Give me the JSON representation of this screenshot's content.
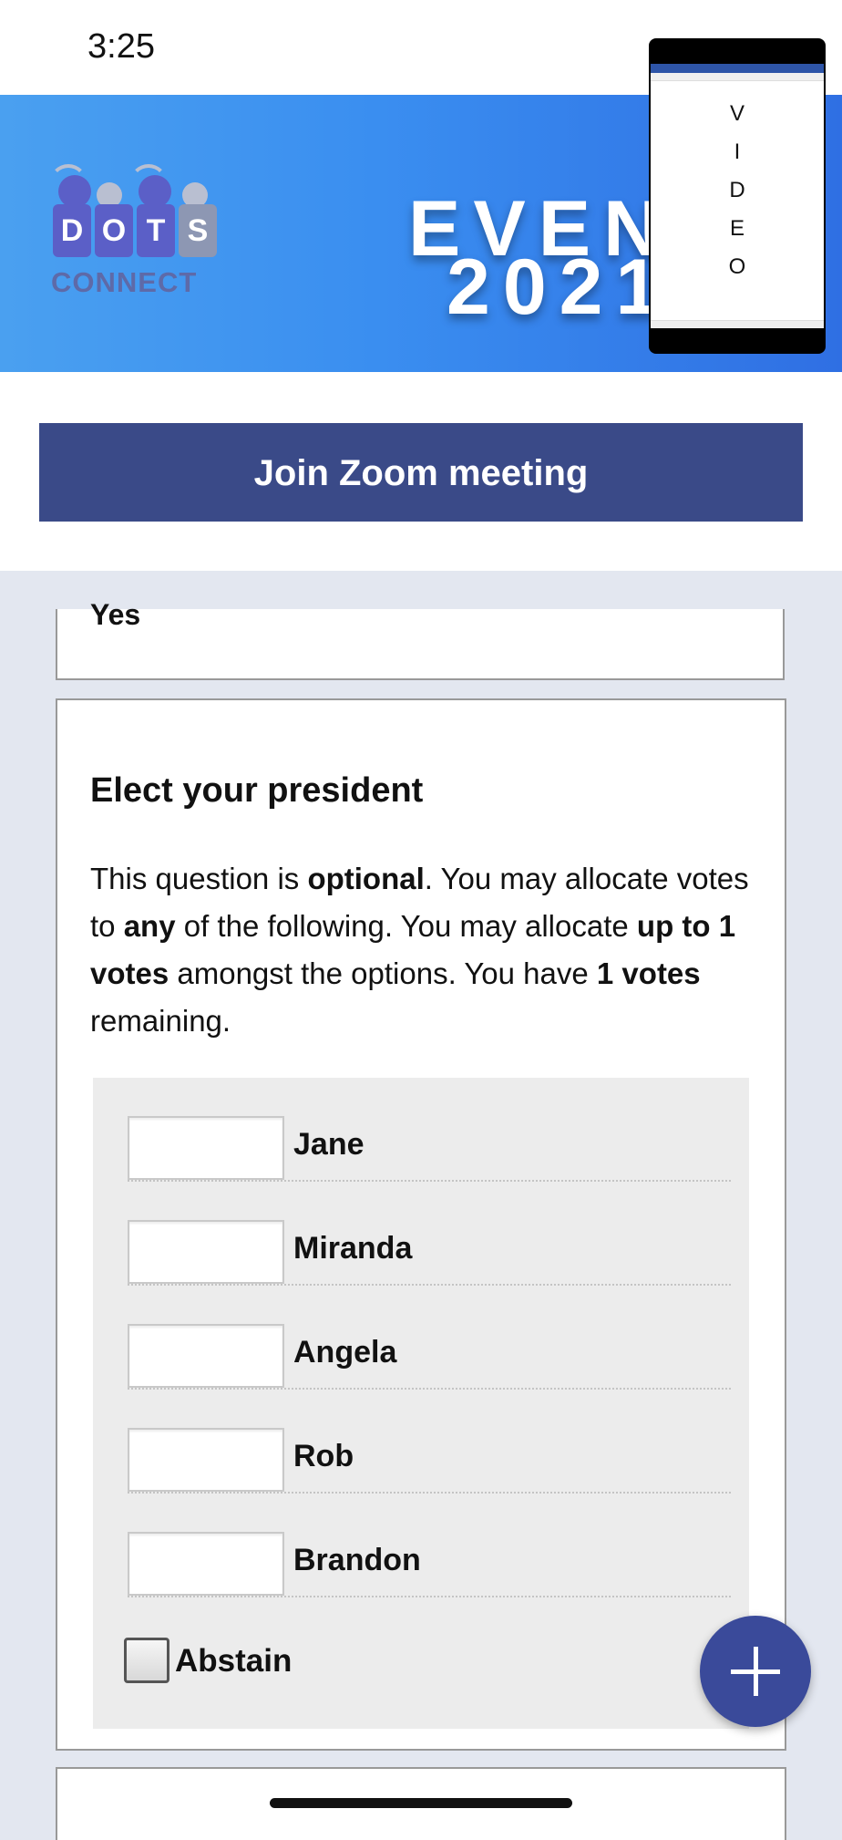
{
  "status_bar": {
    "time": "3:25"
  },
  "banner": {
    "logo": {
      "tiles": [
        "D",
        "O",
        "T",
        "S"
      ],
      "text": "CONNECT"
    },
    "title_line1": "EVEN",
    "title_line2": "2021"
  },
  "video_overlay": {
    "letters": [
      "V",
      "I",
      "D",
      "E",
      "O"
    ]
  },
  "zoom": {
    "button_label": "Join Zoom meeting"
  },
  "previous_card": {
    "cut_text": "Yes"
  },
  "question": {
    "title": "Elect your president",
    "desc": {
      "p1": "This question is ",
      "b1": "optional",
      "p2": ". You may allocate votes to ",
      "b2": "any",
      "p3": " of the following. You may allocate ",
      "b3": "up to 1 votes",
      "p4": " amongst the options. You have ",
      "b4": "1 votes",
      "p5": " remaining."
    },
    "options": [
      {
        "label": "Jane",
        "value": ""
      },
      {
        "label": "Miranda",
        "value": ""
      },
      {
        "label": "Angela",
        "value": ""
      },
      {
        "label": "Rob",
        "value": ""
      },
      {
        "label": "Brandon",
        "value": ""
      }
    ],
    "abstain_label": "Abstain",
    "abstain_checked": false
  },
  "fab": {
    "icon": "plus-icon"
  },
  "colors": {
    "banner": "#3a8ef0",
    "button": "#3a4a88",
    "fab": "#3a4a9a",
    "page_bg": "#e3e7f0"
  }
}
